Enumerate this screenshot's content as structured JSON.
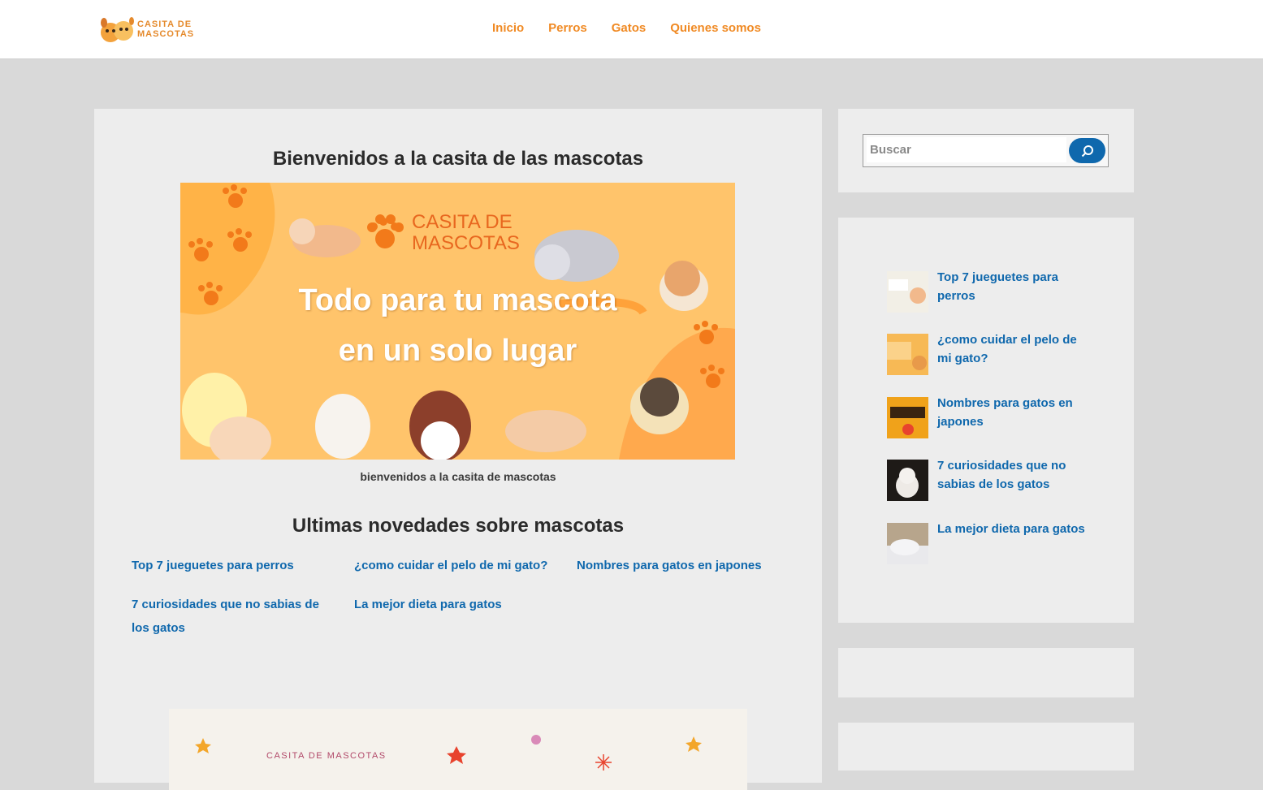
{
  "header": {
    "logo_text_line1": "CASITA DE",
    "logo_text_line2": "MASCOTAS",
    "nav": [
      "Inicio",
      "Perros",
      "Gatos",
      "Quienes somos"
    ]
  },
  "main": {
    "title": "Bienvenidos a la casita de las mascotas",
    "banner": {
      "brand_line1": "CASITA DE",
      "brand_line2": "MASCOTAS",
      "headline_line1": "Todo para tu mascota",
      "headline_line2": "en un solo lugar"
    },
    "caption": "bienvenidos a la casita de mascotas",
    "news_title": "Ultimas novedades sobre mascotas",
    "news": [
      "Top 7 jueguetes para perros",
      "¿como cuidar el pelo de mi gato?",
      "Nombres para gatos en japones",
      "7 curiosidades que no sabias de los gatos",
      "La mejor dieta para gatos"
    ],
    "footer_image_text": "CASITA DE MASCOTAS"
  },
  "sidebar": {
    "search_placeholder": "Buscar",
    "posts": [
      "Top 7 jueguetes para perros",
      "¿como cuidar el pelo de mi gato?",
      "Nombres para gatos en japones",
      "7 curiosidades que no sabias de los gatos",
      "La mejor dieta para gatos"
    ]
  },
  "colors": {
    "accent_orange": "#f08a24",
    "link_blue": "#0f68ad",
    "banner_bg": "#ffc46b"
  }
}
